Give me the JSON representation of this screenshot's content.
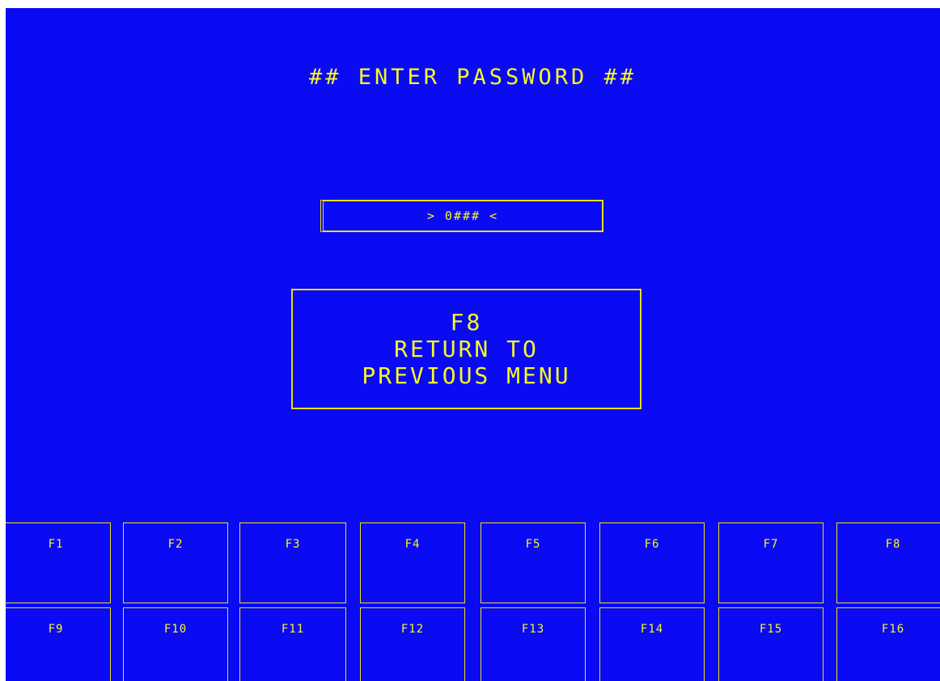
{
  "screen": {
    "title": "## ENTER PASSWORD ##",
    "password_display": "> 0### <",
    "return_button": {
      "key": "F8",
      "line1": "RETURN TO",
      "line2": "PREVIOUS MENU"
    }
  },
  "function_keys": {
    "row1": [
      "F1",
      "F2",
      "F3",
      "F4",
      "F5",
      "F6",
      "F7",
      "F8"
    ],
    "row2": [
      "F9",
      "F10",
      "F11",
      "F12",
      "F13",
      "F14",
      "F15",
      "F16"
    ]
  },
  "colors": {
    "background": "#0a0af5",
    "text": "#f7f728",
    "border": "#e8e01a"
  }
}
